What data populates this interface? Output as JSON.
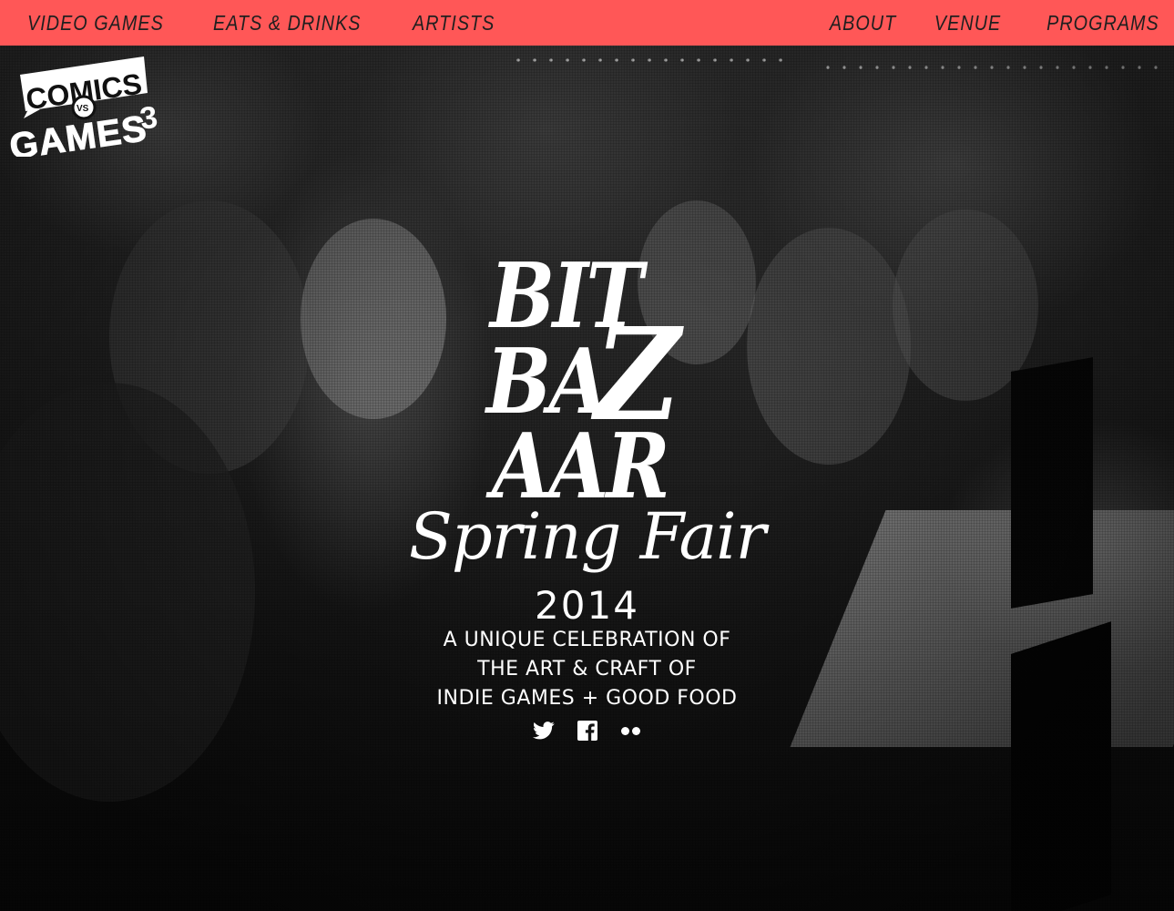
{
  "nav": {
    "left_items": [
      {
        "label": "VIDEO GAMES"
      },
      {
        "label": "EATS & DRINKS"
      },
      {
        "label": "ARTISTS"
      }
    ],
    "right_items": [
      {
        "label": "ABOUT"
      },
      {
        "label": "VENUE"
      },
      {
        "label": "PROGRAMS"
      }
    ],
    "background_color": "#ff5757",
    "text_color": "#1f1f1f"
  },
  "logo": {
    "word_top": "COMICS",
    "word_mid": "VS",
    "word_bottom": "GAMES",
    "number": "3"
  },
  "hero": {
    "title_line1": "BIT",
    "title_z": "Z",
    "title_line2": "BA",
    "title_line3": "AAR",
    "script_subtitle": "Spring Fair",
    "year": "2014",
    "tagline": [
      "A UNIQUE CELEBRATION OF",
      "THE ART & CRAFT OF",
      "INDIE GAMES + GOOD FOOD"
    ],
    "text_color": "#ffffff"
  },
  "social": [
    {
      "icon": "twitter-icon"
    },
    {
      "icon": "facebook-icon"
    },
    {
      "icon": "flickr-icon"
    }
  ]
}
